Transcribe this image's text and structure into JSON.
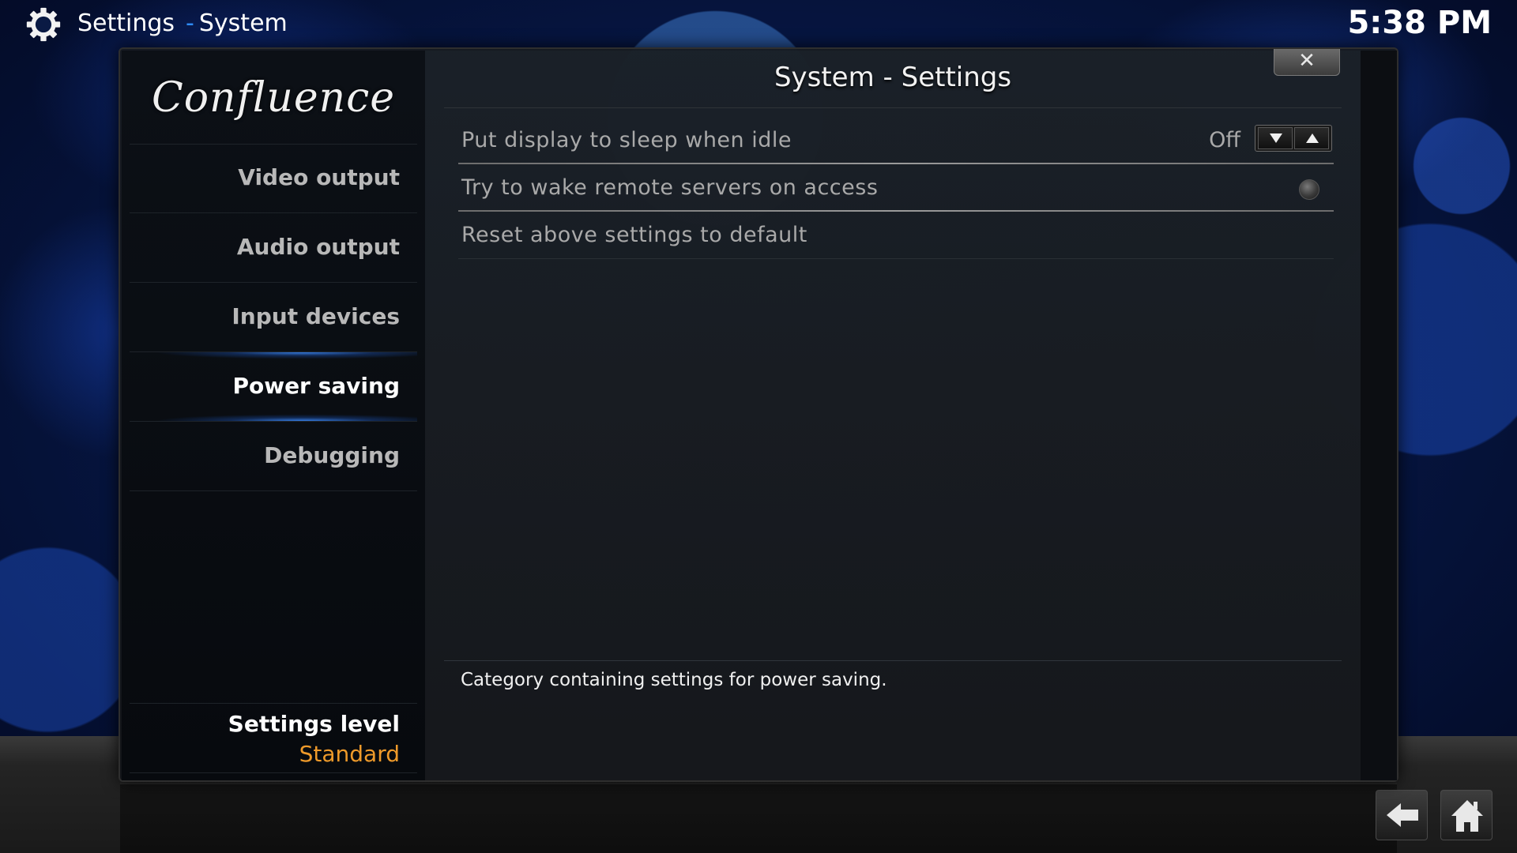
{
  "header": {
    "title": "Settings",
    "separator": "-",
    "subtitle": "System",
    "icon": "gear-icon",
    "clock": "5:38 PM"
  },
  "sidebar": {
    "logo": "Confluence",
    "items": [
      {
        "label": "Video output",
        "active": false
      },
      {
        "label": "Audio output",
        "active": false
      },
      {
        "label": "Input devices",
        "active": false
      },
      {
        "label": "Power saving",
        "active": true
      },
      {
        "label": "Debugging",
        "active": false
      }
    ],
    "settings_level_title": "Settings level",
    "settings_level_value": "Standard"
  },
  "dialog": {
    "title": "System - Settings",
    "close_label": "✕",
    "settings": [
      {
        "label": "Put display to sleep when idle",
        "value": "Off",
        "control": "spinner",
        "selected": true
      },
      {
        "label": "Try to wake remote servers on access",
        "value": "",
        "control": "radio",
        "checked": false
      },
      {
        "label": "Reset above settings to default",
        "value": "",
        "control": "button"
      }
    ],
    "description": "Category containing settings for power saving."
  },
  "footer": {
    "back_icon": "back-arrow-icon",
    "home_icon": "home-icon"
  },
  "colors": {
    "accent": "#2f8cff",
    "level_value": "#ee9a2a"
  }
}
